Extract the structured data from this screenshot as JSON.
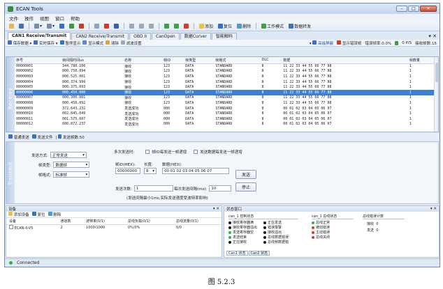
{
  "window": {
    "title": "ECAN Tools"
  },
  "menu": [
    "文件",
    "操作",
    "视图",
    "窗口",
    "帮助"
  ],
  "toolbar": {
    "add": "添加",
    "reset": "复位",
    "delete": "删除",
    "workmode": "工作模式",
    "forward": "数据转发"
  },
  "tabs": [
    "CAN1 Receive/Transmit",
    "CAN2 Receive/Transmit",
    "OBD II",
    "CanOpen",
    "数据Curver",
    "智能解码"
  ],
  "subtoolbar": {
    "save": "保存数据",
    "realtime_save": "实时保存",
    "pause": "暂停显示",
    "display_mode": "显示模式",
    "clear": "清除",
    "filter": "滤波设置",
    "adv_filter": "高级屏蔽",
    "show_errors": "显示错误帧",
    "error_rate": "错误帧率:0.0%",
    "rate": "0 P/S",
    "recv_count": "接收帧数:15"
  },
  "grid": {
    "side_label": "Receive",
    "headers": [
      "序号",
      "帧间隔时间us",
      "名称",
      "帧ID",
      "帧类型",
      "帧格式",
      "DLC",
      "数据",
      "帧数量"
    ],
    "selected_index": 5,
    "rows": [
      [
        "00000001",
        "344.780.100",
        "接收",
        "123",
        "DATA",
        "STANDARD",
        "8",
        "11 22 33 44 55 66 77 88",
        "1"
      ],
      [
        "00000002",
        "000.750.094",
        "接收",
        "123",
        "DATA",
        "STANDARD",
        "8",
        "11 22 33 44 55 66 77 88",
        "1"
      ],
      [
        "00000003",
        "000.525.001",
        "接收",
        "123",
        "DATA",
        "STANDARD",
        "8",
        "11 22 33 44 55 66 77 88",
        "1"
      ],
      [
        "00000004",
        "000.374.999",
        "接收",
        "123",
        "DATA",
        "STANDARD",
        "8",
        "11 22 33 44 55 66 77 88",
        "1"
      ],
      [
        "00000005",
        "000.375.093",
        "接收",
        "123",
        "DATA",
        "STANDARD",
        "8",
        "11 22 33 44 55 66 77 88",
        "1"
      ],
      [
        "00000006",
        "000.450.000",
        "接收",
        "123",
        "DATA",
        "STANDARD",
        "8",
        "11 22 33 44 55 66 77 88",
        "1"
      ],
      [
        "00000007",
        "000.300.001",
        "接收",
        "123",
        "DATA",
        "STANDARD",
        "8",
        "11 22 33 44 55 66 77 88",
        "1"
      ],
      [
        "00000008",
        "000.450.092",
        "接收",
        "123",
        "DATA",
        "STANDARD",
        "8",
        "11 22 33 44 55 66 77 88",
        "1"
      ],
      [
        "00000009",
        "372.643.232",
        "发送成功",
        "000",
        "DATA",
        "STANDARD",
        "8",
        "00 01 02 03 04 05 06 07",
        "1"
      ],
      [
        "00000010",
        "002.845.049",
        "发送成功",
        "000",
        "DATA",
        "STANDARD",
        "8",
        "00 01 02 03 04 05 06 07",
        "1"
      ],
      [
        "00000011",
        "001.575.607",
        "发送成功",
        "000",
        "DATA",
        "STANDARD",
        "8",
        "00 01 02 03 04 05 06 07",
        "1"
      ],
      [
        "00000012",
        "000.872.237",
        "发送成功",
        "000",
        "DATA",
        "STANDARD",
        "8",
        "00 01 02 03 04 05 06 07",
        "1"
      ]
    ]
  },
  "sendtabs": {
    "normal": "普通发送",
    "file": "发送文件",
    "count": "发送帧数:50"
  },
  "send": {
    "side_label": "Transmit",
    "mode_label": "发送方式:",
    "mode_value": "正常发送",
    "multi_label": "多次发送时:",
    "inc_id": "帧ID每发送一帧递增",
    "inc_data": "发送数据每发送一帧递增",
    "type_label": "帧类型:",
    "type_value": "数据帧",
    "format_label": "帧格式:",
    "format_value": "标准帧",
    "id_label": "帧ID(HEX):",
    "id_value": "00000000",
    "len_label": "长度:",
    "len_value": "8",
    "data_label": "数据(HEX):",
    "data_value": "00 01 02 03 04 05 06 07",
    "send_btn": "发送",
    "times_label": "发送次数:",
    "times_value": "1",
    "interval_label": "每次发送间隔(ms):",
    "interval_value": "10",
    "stop_btn": "停止",
    "hint": "(发送间隔最小1ms,实际发送速度受波特率影响)"
  },
  "device": {
    "title": "设备",
    "add": "添加设备",
    "reset": "复位",
    "delete": "删除",
    "headers": [
      "设备",
      "通道数",
      "波特率(0/1)",
      "总线负载(0/1)",
      "总线流量(0/1)"
    ],
    "rows": [
      [
        "ECAN-II-V5",
        "2",
        "1000/1000",
        "0%/0%",
        "0/0"
      ]
    ]
  },
  "status": {
    "title": "状态窗口",
    "ctrl_title": "can_1 控制状态",
    "ctrl_items": [
      [
        "接收寄存器满",
        "正在发送"
      ],
      [
        "接收寄存器溢出",
        "错误报警"
      ],
      [
        "发送寄存器空",
        "接收溢出"
      ],
      [
        "发送结束",
        "总线数据错误"
      ],
      [
        "正在接收",
        "总线帧数据错"
      ]
    ],
    "bus_title": "can_1 总线状态",
    "bus_items": [
      "总线正常",
      "被动错误",
      "主动错误",
      "总线关闭"
    ],
    "err_title": "总线错误计数",
    "recv_label": "接收",
    "recv_val": "0",
    "send_label": "发送",
    "send_val": "0",
    "tabs": [
      "Can1 状态",
      "Can2 状态"
    ]
  },
  "statusbar": {
    "connected": "Connected"
  },
  "caption": "图 5.2.3",
  "colors": {
    "selected_row": "#3d7fd6",
    "green_led": "#2fb34a",
    "red_led": "#d83b2b"
  }
}
